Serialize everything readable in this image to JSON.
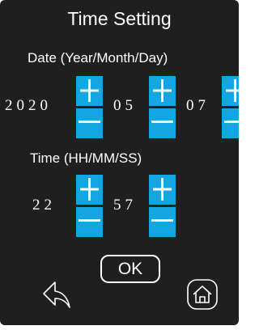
{
  "title": "Time Setting",
  "date": {
    "label": "Date (Year/Month/Day)",
    "year": "2020",
    "month": "05",
    "day": "07"
  },
  "time": {
    "label": "Time (HH/MM/SS)",
    "hour": "22",
    "minute": "57"
  },
  "ok_label": "OK",
  "icons": {
    "back": "back-arrow-icon",
    "home": "home-icon",
    "plus": "plus-icon",
    "minus": "minus-icon"
  },
  "colors": {
    "background": "#1f1f1f",
    "stepper": "#14a6e3",
    "text": "#ffffff"
  }
}
